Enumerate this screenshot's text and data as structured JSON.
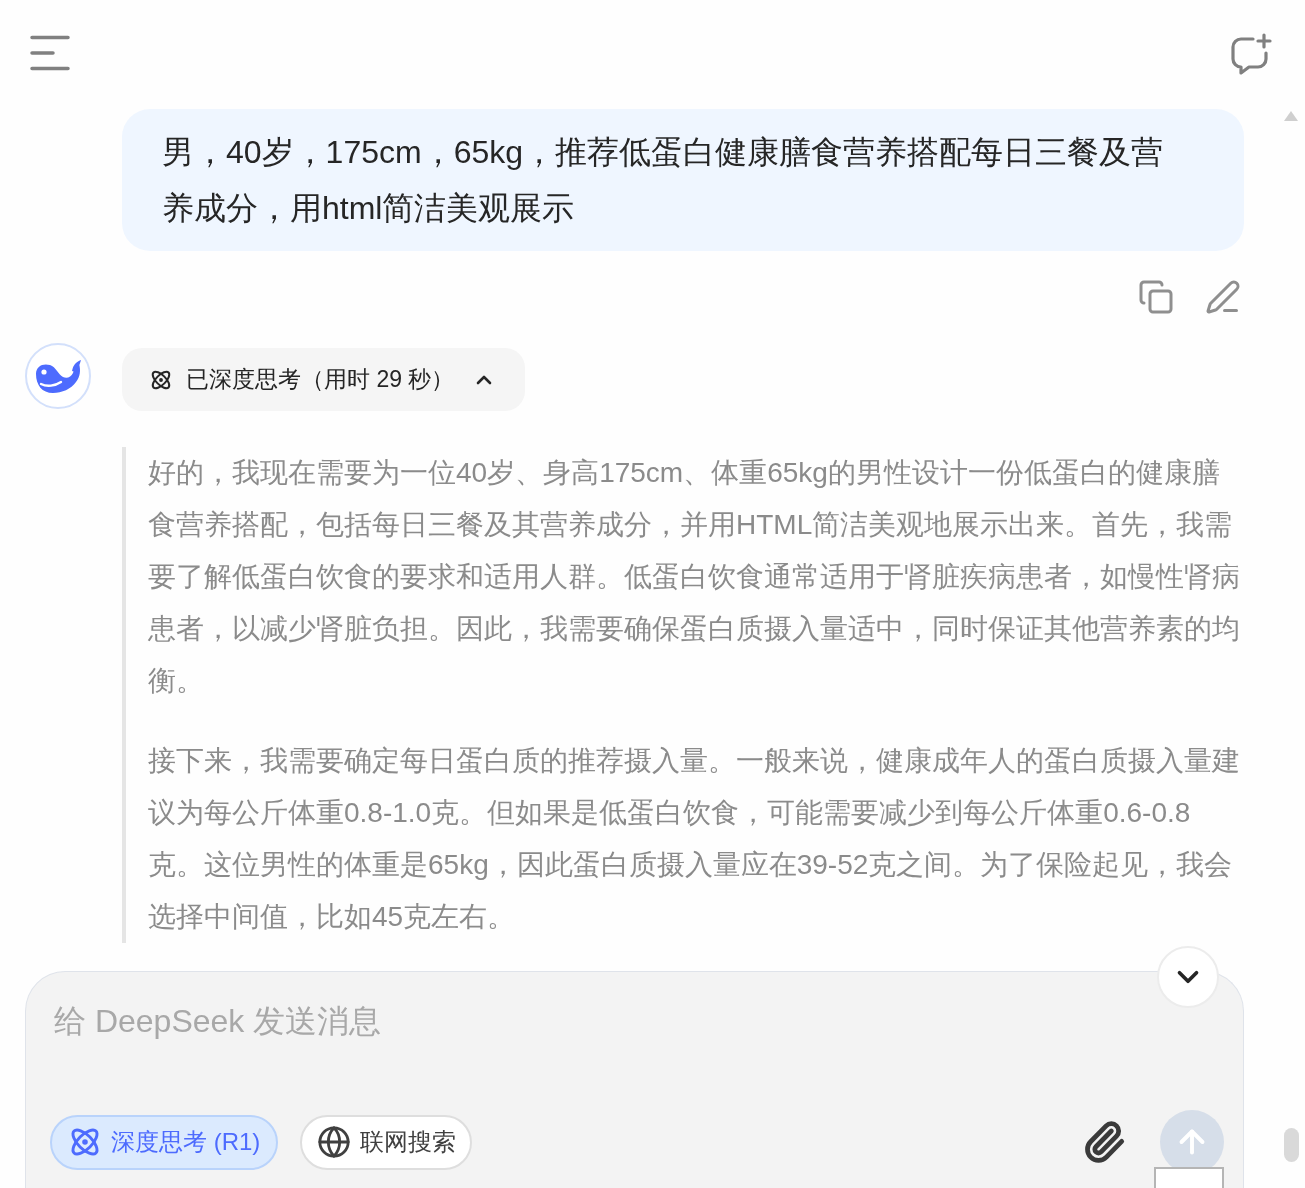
{
  "user_message": {
    "text": "男，40岁，175cm，65kg，推荐低蛋白健康膳食营养搭配每日三餐及营养成分，用html简洁美观展示"
  },
  "assistant_message": {
    "thinking_toggle": {
      "label": "已深度思考（用时 29 秒）",
      "expanded": true
    },
    "thinking_paragraphs": [
      "好的，我现在需要为一位40岁、身高175cm、体重65kg的男性设计一份低蛋白的健康膳食营养搭配，包括每日三餐及其营养成分，并用HTML简洁美观地展示出来。首先，我需要了解低蛋白饮食的要求和适用人群。低蛋白饮食通常适用于肾脏疾病患者，如慢性肾病患者，以减少肾脏负担。因此，我需要确保蛋白质摄入量适中，同时保证其他营养素的均衡。",
      "接下来，我需要确定每日蛋白质的推荐摄入量。一般来说，健康成年人的蛋白质摄入量建议为每公斤体重0.8-1.0克。但如果是低蛋白饮食，可能需要减少到每公斤体重0.6-0.8克。这位男性的体重是65kg，因此蛋白质摄入量应在39-52克之间。为了保险起见，我会选择中间值，比如45克左右。"
    ]
  },
  "composer": {
    "placeholder": "给 DeepSeek 发送消息",
    "toggles": [
      {
        "kind": "reasoning",
        "label": "深度思考 (R1)",
        "selected": true
      },
      {
        "kind": "search",
        "label": "联网搜索",
        "selected": false
      }
    ],
    "send_button": {
      "disabled": true
    }
  }
}
